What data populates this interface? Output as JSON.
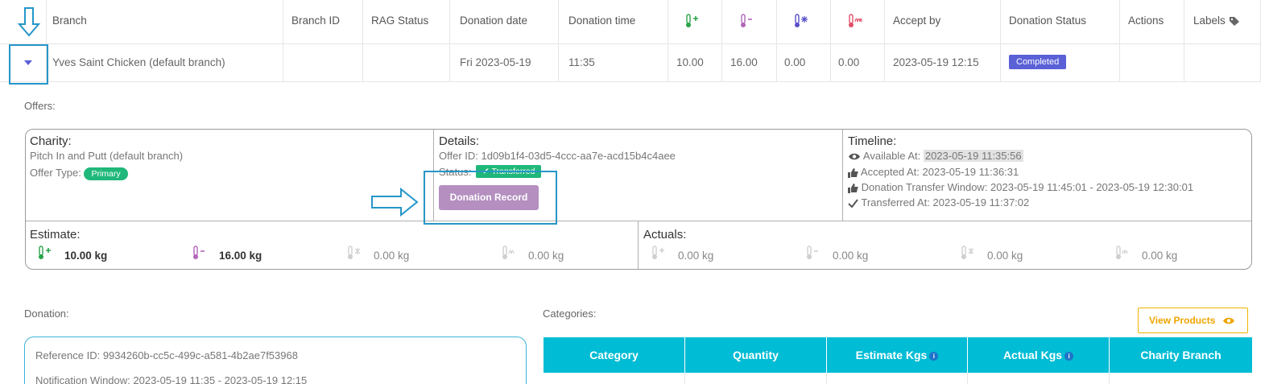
{
  "table": {
    "headers": {
      "branch": "Branch",
      "branch_id": "Branch ID",
      "rag_status": "RAG Status",
      "donation_date": "Donation date",
      "donation_time": "Donation time",
      "ambient_plus": "†+",
      "chilled_minus": "–",
      "frozen": "✻",
      "hot": "m",
      "accept_by": "Accept by",
      "donation_status": "Donation Status",
      "actions": "Actions",
      "labels": "Labels"
    },
    "row": {
      "branch": "Yves Saint Chicken (default branch)",
      "branch_id": "",
      "rag_status": "",
      "donation_date": "Fri 2023-05-19",
      "donation_time": "11:35",
      "v1": "10.00",
      "v2": "16.00",
      "v3": "0.00",
      "v4": "0.00",
      "accept_by": "2023-05-19 12:15",
      "status": "Completed"
    }
  },
  "offers": {
    "label": "Offers:",
    "charity": {
      "title": "Charity:",
      "name": "Pitch In and Putt (default branch)",
      "offer_type_label": "Offer Type:",
      "offer_type": "Primary"
    },
    "details": {
      "title": "Details:",
      "offer_id": "Offer ID: 1d09b1f4-03d5-4ccc-aa7e-acd15b4c4aee",
      "status_label": "Status:",
      "status": "✔ Transferred",
      "button": "Donation Record"
    },
    "timeline": {
      "title": "Timeline:",
      "available_label": "Available At:",
      "available": "2023-05-19 11:35:56",
      "accepted": "Accepted At:  2023-05-19 11:36:31",
      "window": "Donation Transfer Window: 2023-05-19 11:45:01 - 2023-05-19 12:30:01",
      "transferred": "Transferred At:  2023-05-19 11:37:02"
    },
    "estimate": {
      "title": "Estimate:",
      "values": [
        "10.00 kg",
        "16.00 kg",
        "0.00 kg",
        "0.00 kg"
      ]
    },
    "actuals": {
      "title": "Actuals:",
      "values": [
        "0.00 kg",
        "0.00 kg",
        "0.00 kg",
        "0.00 kg"
      ]
    }
  },
  "donation": {
    "label": "Donation:",
    "reference": "Reference ID: 9934260b-cc5c-499c-a581-4b2ae7f53968",
    "notification": "Notification Window: 2023-05-19 11:35 - 2023-05-19 12:15"
  },
  "categories": {
    "label": "Categories:",
    "view_products": "View Products",
    "headers": [
      "Category",
      "Quantity",
      "Estimate Kgs",
      "Actual Kgs",
      "Charity Branch"
    ]
  },
  "colors": {
    "ambient": "#2aa34a",
    "chilled": "#b266b8",
    "frozen": "#5a50c8",
    "hot": "#e0506a",
    "highlight": "#2596c8",
    "completed": "#5a60d6",
    "transferred": "#1fb87a",
    "cyan_header": "#00bcd4"
  }
}
